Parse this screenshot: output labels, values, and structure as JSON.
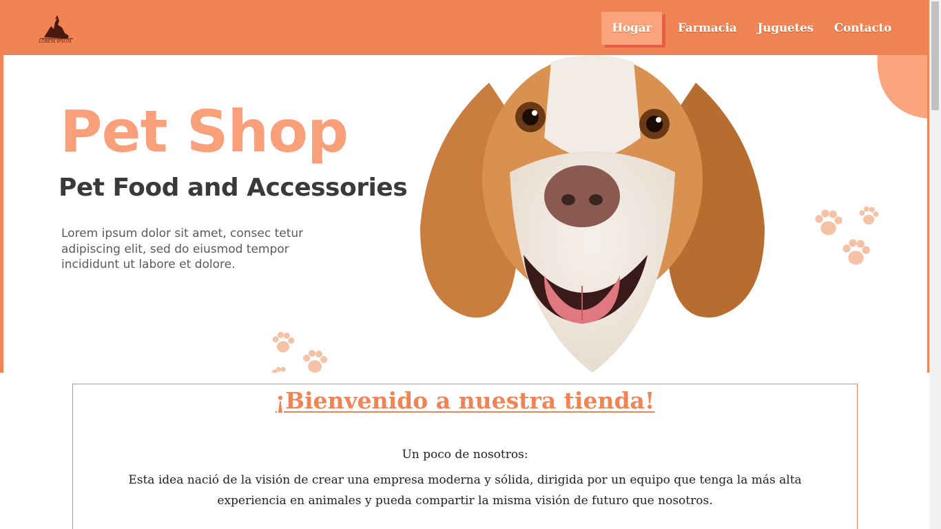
{
  "header": {
    "logo_text": "LOREM IPSUM",
    "nav": [
      {
        "label": "Hogar",
        "active": true
      },
      {
        "label": "Farmacia",
        "active": false
      },
      {
        "label": "Juguetes",
        "active": false
      },
      {
        "label": "Contacto",
        "active": false
      }
    ]
  },
  "hero": {
    "title": "Pet Shop",
    "subtitle": "Pet Food and Accessories",
    "text": "Lorem ipsum dolor sit amet, consec tetur adipiscing elit, sed do eiusmod tempor incididunt ut labore et dolore."
  },
  "welcome": {
    "title": "¡Bienvenido a nuestra tienda!",
    "about_heading": "Un poco de nosotros:",
    "about_body": "Esta idea nació de la visión de crear una empresa moderna y sólida, dirigida por un equipo que tenga la más alta experiencia en animales y pueda compartir la misma visión de futuro que nosotros."
  },
  "colors": {
    "brand": "#f08454",
    "accent_light": "#f9a47b",
    "accent_shadow": "#ef5b4a"
  }
}
